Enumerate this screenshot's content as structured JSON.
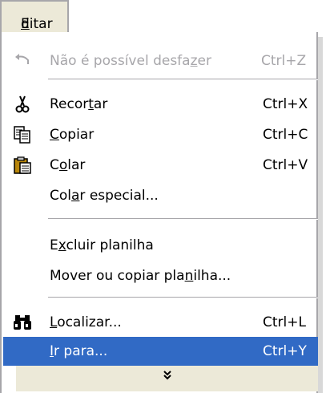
{
  "menubar": {
    "tab_parts": [
      "",
      "E",
      "ditar"
    ]
  },
  "menu": {
    "undo": {
      "parts": [
        "Não é possível desfa",
        "z",
        "er"
      ],
      "shortcut": "Ctrl+Z",
      "icon": "undo-icon"
    },
    "cut": {
      "parts": [
        "Recor",
        "t",
        "ar"
      ],
      "shortcut": "Ctrl+X",
      "icon": "scissors-icon"
    },
    "copy": {
      "parts": [
        "",
        "C",
        "opiar"
      ],
      "shortcut": "Ctrl+C",
      "icon": "copy-icon"
    },
    "paste": {
      "parts": [
        "C",
        "o",
        "lar"
      ],
      "shortcut": "Ctrl+V",
      "icon": "paste-icon"
    },
    "paste_special": {
      "parts": [
        "Col",
        "a",
        "r especial..."
      ]
    },
    "delete_sheet": {
      "parts": [
        "E",
        "x",
        "cluir planilha"
      ]
    },
    "move_sheet": {
      "parts": [
        "Mover ou copiar pla",
        "n",
        "ilha..."
      ]
    },
    "find": {
      "parts": [
        "",
        "L",
        "ocalizar..."
      ],
      "shortcut": "Ctrl+L",
      "icon": "binoculars-icon"
    },
    "goto": {
      "parts": [
        "",
        "I",
        "r para..."
      ],
      "shortcut": "Ctrl+Y"
    },
    "expand": {
      "glyph": "˅˅",
      "icon": "double-chevron-down-icon"
    }
  },
  "colors": {
    "highlight": "#316ac5",
    "disabled_text": "#a7a6aa",
    "menubar": "#ece9d8"
  }
}
